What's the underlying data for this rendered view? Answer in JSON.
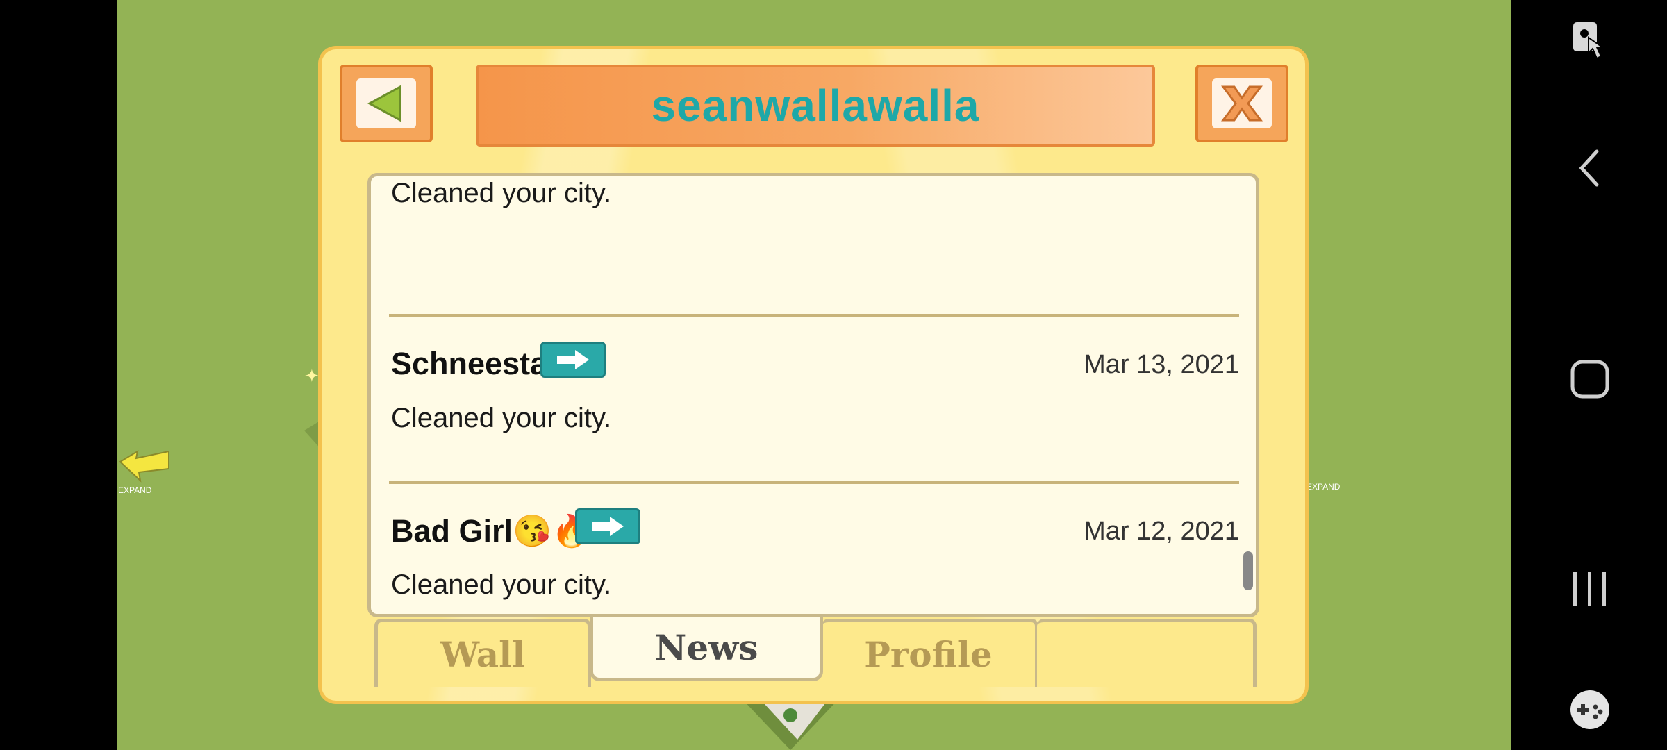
{
  "dialog": {
    "title": "seanwallawalla"
  },
  "news": {
    "partial_message": "Cleaned your city.",
    "entries": [
      {
        "name": "Schneestadt",
        "date": "Mar 13, 2021",
        "message": "Cleaned your city."
      },
      {
        "name": "Bad Girl😘🔥",
        "date": "Mar 12, 2021",
        "message": "Cleaned your city."
      }
    ]
  },
  "tabs": {
    "wall": "Wall",
    "news": "News",
    "profile": "Profile",
    "active": "news"
  },
  "colors": {
    "title_text": "#1ea8a8",
    "dialog_bg": "#fde98c",
    "panel_bg": "#fffbe6",
    "go_button": "#2aa9a8",
    "grass": "#93b355"
  },
  "icons": {
    "back": "green-left-triangle",
    "close": "orange-x",
    "go": "white-right-arrow",
    "nav_screenshot": "screen-capture-icon",
    "nav_back": "chevron-left",
    "nav_home": "rounded-square",
    "nav_recents": "three-bars",
    "nav_game": "gamepad"
  }
}
